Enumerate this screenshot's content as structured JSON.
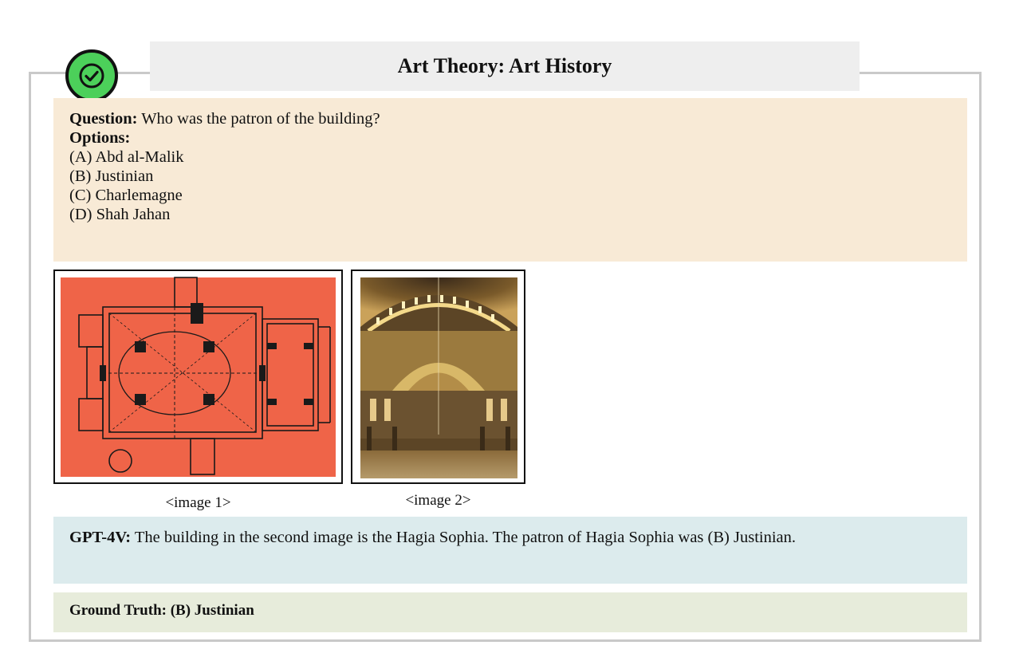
{
  "header": {
    "title": "Art Theory: Art History",
    "badge_icon": "check-icon",
    "badge_color": "#4cd05a"
  },
  "question": {
    "label": "Question:",
    "text": "Who was the patron of the building?",
    "options_label": "Options:",
    "options": [
      "(A) Abd al-Malik",
      "(B) Justinian",
      "(C) Charlemagne",
      "(D) Shah Jahan"
    ],
    "bg_color": "#f8ead6"
  },
  "images": [
    {
      "caption": "<image 1>",
      "content": "floor-plan",
      "bg_color": "#ef6448"
    },
    {
      "caption": "<image 2>",
      "content": "dome-interior"
    }
  ],
  "answer": {
    "label": "GPT-4V:",
    "text": "The building in the second image is the Hagia Sophia. The patron of Hagia Sophia was (B) Justinian.",
    "bg_color": "#dcebed"
  },
  "ground_truth": {
    "text": "Ground Truth: (B) Justinian",
    "bg_color": "#e7ecdb"
  }
}
